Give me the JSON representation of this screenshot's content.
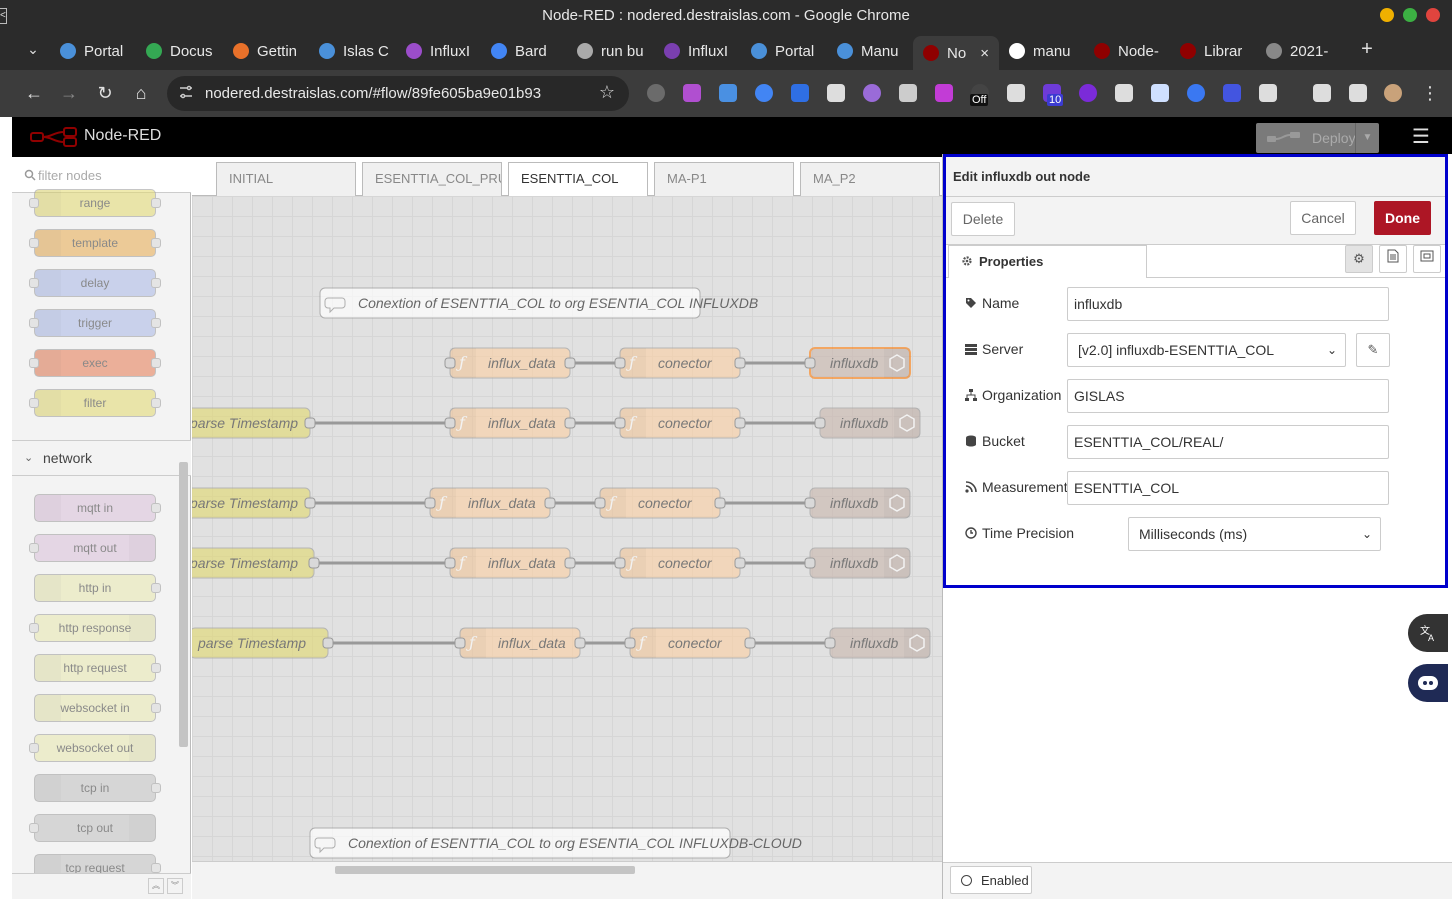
{
  "window": {
    "title": "Node-RED : nodered.destraislas.com - Google Chrome",
    "left_edge_mark": "<"
  },
  "tabs": [
    {
      "label": "Portal",
      "color": "#4a90d9"
    },
    {
      "label": "Docus",
      "color": "#34a853"
    },
    {
      "label": "Gettin",
      "color": "#e8712a"
    },
    {
      "label": "Islas C",
      "color": "#4a90d9"
    },
    {
      "label": "InfluxI",
      "color": "#9b4dca"
    },
    {
      "label": "Bard",
      "color": "#4285f4"
    },
    {
      "label": "run bu",
      "color": "#aaaaaa"
    },
    {
      "label": "InfluxI",
      "color": "#7a3fb0"
    },
    {
      "label": "Portal",
      "color": "#4a90d9"
    },
    {
      "label": "Manu",
      "color": "#4a90d9"
    },
    {
      "label": "No",
      "color": "#8f0000",
      "active": true
    },
    {
      "label": "manu",
      "color": "#ffffff"
    },
    {
      "label": "Node-",
      "color": "#8f0000"
    },
    {
      "label": "Librar",
      "color": "#8f0000"
    },
    {
      "label": "2021-",
      "color": "#888888"
    }
  ],
  "tab_close_glyph": "×",
  "new_tab_glyph": "+",
  "tab_search_glyph": "⌄",
  "toolbar": {
    "url": "nodered.destraislas.com/#flow/89fe605ba9e01b93",
    "back_glyph": "←",
    "forward_glyph": "→",
    "reload_glyph": "↻",
    "home_glyph": "⌂",
    "star_glyph": "☆",
    "ext_badge_off": "Off",
    "ext_badge_count": "10",
    "menu_glyph": "⋮"
  },
  "nodered": {
    "app_name": "Node-RED",
    "deploy_label": "Deploy",
    "menu_glyph": "☰"
  },
  "palette": {
    "filter_placeholder": "filter nodes",
    "category": "network",
    "function_nodes": [
      {
        "label": "range",
        "color": "#e2d96e"
      },
      {
        "label": "template",
        "color": "#e7a94d"
      },
      {
        "label": "delay",
        "color": "#a7b7e6"
      },
      {
        "label": "trigger",
        "color": "#a7b7e6"
      },
      {
        "label": "exec",
        "color": "#e57950"
      },
      {
        "label": "filter",
        "color": "#e2d96e"
      }
    ],
    "network_nodes": [
      {
        "label": "mqtt in",
        "color": "#d8bfd8",
        "side": "in"
      },
      {
        "label": "mqtt out",
        "color": "#d8bfd8",
        "side": "out"
      },
      {
        "label": "http in",
        "color": "#e7e7ae",
        "side": "in"
      },
      {
        "label": "http response",
        "color": "#e7e7ae",
        "side": "out"
      },
      {
        "label": "http request",
        "color": "#e7e7ae",
        "side": "in"
      },
      {
        "label": "websocket in",
        "color": "#e7e7ae",
        "side": "in"
      },
      {
        "label": "websocket out",
        "color": "#e7e7ae",
        "side": "out"
      },
      {
        "label": "tcp in",
        "color": "#c0c0c0",
        "side": "in"
      },
      {
        "label": "tcp out",
        "color": "#c0c0c0",
        "side": "out"
      },
      {
        "label": "tcp request",
        "color": "#c0c0c0",
        "side": "in"
      }
    ]
  },
  "workspace": {
    "tabs": [
      {
        "label": "INITIAL"
      },
      {
        "label": "ESENTTIA_COL_PRUEB"
      },
      {
        "label": "ESENTTIA_COL",
        "active": true
      },
      {
        "label": "MA-P1"
      },
      {
        "label": "MA_P2"
      }
    ],
    "comments": [
      "Conextion of ESENTTIA_COL to org ESENTIA_COL INFLUXDB",
      "Conextion of ESENTTIA_COL to org ESENTIA_COL INFLUXDB-CLOUD"
    ],
    "flow_rows": [
      {
        "source": "",
        "nodes": [
          "influx_data",
          "conector",
          "influxdb"
        ],
        "selected_out": true
      },
      {
        "source": "parse Timestamp",
        "nodes": [
          "influx_data",
          "conector",
          "influxdb"
        ]
      },
      {
        "source": "parse Timestamp",
        "nodes": [
          "influx_data",
          "conector",
          "influxdb"
        ]
      },
      {
        "source": "parse Timestamp",
        "nodes": [
          "influx_data",
          "conector",
          "influxdb"
        ]
      },
      {
        "source": "parse Timestamp",
        "nodes": [
          "influx_data",
          "conector",
          "influxdb"
        ]
      }
    ]
  },
  "editor": {
    "title": "Edit influxdb out node",
    "delete_label": "Delete",
    "cancel_label": "Cancel",
    "done_label": "Done",
    "properties_tab": "Properties",
    "fields": {
      "name_label": "Name",
      "name_value": "influxdb",
      "server_label": "Server",
      "server_value": "[v2.0] influxdb-ESENTTIA_COL",
      "org_label": "Organization",
      "org_value": "GISLAS",
      "bucket_label": "Bucket",
      "bucket_value": "ESENTTIA_COL/REAL/",
      "measurement_label": "Measurement",
      "measurement_value": "ESENTTIA_COL",
      "precision_label": "Time Precision",
      "precision_value": "Milliseconds (ms)"
    },
    "enabled_label": "Enabled"
  },
  "colors": {
    "function_node": "#fdd0a2",
    "done_button": "#ad1625",
    "highlight_border": "#0000cc"
  }
}
